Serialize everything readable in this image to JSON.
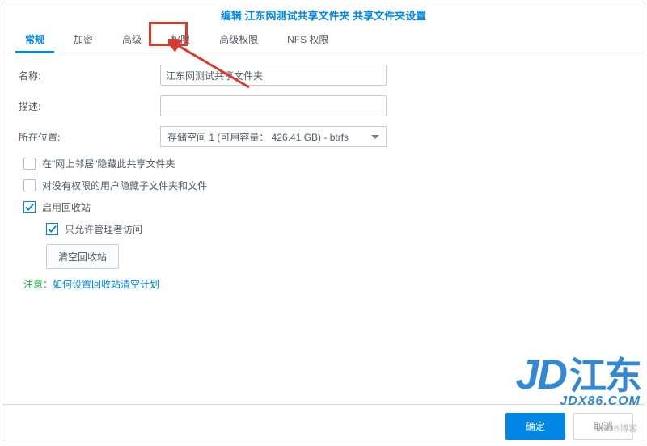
{
  "title": "编辑 江东网测试共享文件夹 共享文件夹设置",
  "tabs": [
    "常规",
    "加密",
    "高级",
    "权限",
    "高级权限",
    "NFS 权限"
  ],
  "activeTab": 0,
  "highlightTab": 3,
  "fields": {
    "name": {
      "label": "名称:",
      "value": "江东网测试共享文件夹"
    },
    "desc": {
      "label": "描述:",
      "value": ""
    },
    "location": {
      "label": "所在位置:",
      "selected": "存储空间 1 (可用容量： 426.41 GB) - btrfs"
    }
  },
  "checks": {
    "hideNeighbor": {
      "label": "在\"网上邻居\"隐藏此共享文件夹",
      "checked": false
    },
    "hideSubForNoPerm": {
      "label": "对没有权限的用户隐藏子文件夹和文件",
      "checked": false
    },
    "enableRecycle": {
      "label": "启用回收站",
      "checked": true
    },
    "adminOnly": {
      "label": "只允许管理者访问",
      "checked": true
    }
  },
  "clearBtn": "清空回收站",
  "note": {
    "prefix": "注意：",
    "link": "如何设置回收站清空计划"
  },
  "footer": {
    "ok": "确定",
    "cancel": "取消"
  },
  "watermark": {
    "jd": "JD",
    "cn": "江东",
    "sub": "JDX86.COM",
    "small": "IHUB博客"
  }
}
